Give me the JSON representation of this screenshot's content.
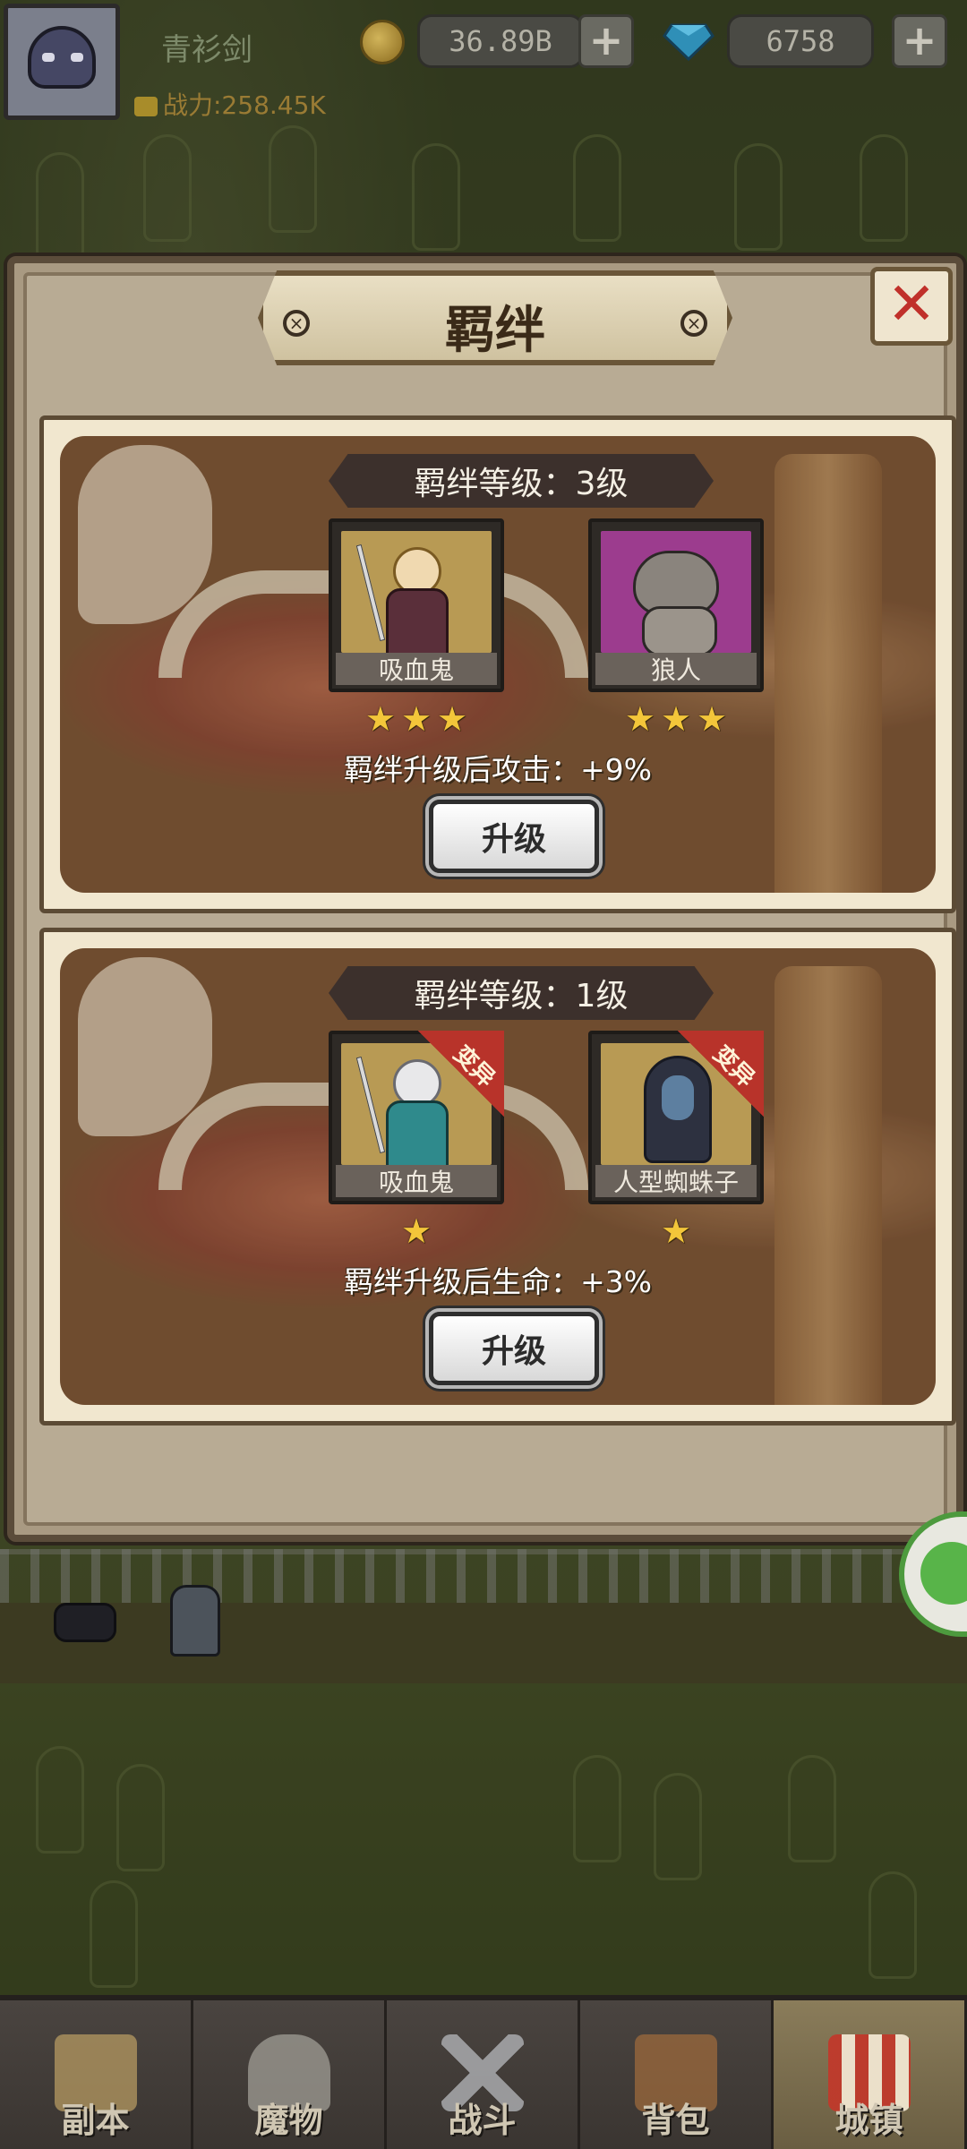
{
  "hud": {
    "player_name": "青衫剑",
    "power_label": "战力:258.45K",
    "gold_amount": "36.89B",
    "gem_amount": "6758",
    "add_symbol": "+"
  },
  "modal": {
    "title": "羁绊",
    "close_symbol": "✕",
    "rivet_symbol": "×"
  },
  "bonds": [
    {
      "level_text": "羁绊等级：3级",
      "heroes": [
        {
          "name": "吸血鬼",
          "stars": 3,
          "mutation": false
        },
        {
          "name": "狼人",
          "stars": 3,
          "mutation": false
        }
      ],
      "bonus_text": "羁绊升级后攻击：+9%",
      "upgrade_label": "升级"
    },
    {
      "level_text": "羁绊等级：1级",
      "heroes": [
        {
          "name": "吸血鬼",
          "stars": 1,
          "mutation": true,
          "mutation_label": "变异"
        },
        {
          "name": "人型蜘蛛子",
          "stars": 1,
          "mutation": true,
          "mutation_label": "变异"
        }
      ],
      "bonus_text": "羁绊升级后生命：+3%",
      "upgrade_label": "升级"
    }
  ],
  "nav": {
    "items": [
      {
        "label": "副本",
        "icon": "map-icon"
      },
      {
        "label": "魔物",
        "icon": "helmet-icon"
      },
      {
        "label": "战斗",
        "icon": "swords-icon"
      },
      {
        "label": "背包",
        "icon": "backpack-icon"
      },
      {
        "label": "城镇",
        "icon": "shop-icon"
      }
    ],
    "active_index": 4
  },
  "colors": {
    "gold": "#f3c63a",
    "close_red": "#c0302a",
    "mutation_red": "#b8332a",
    "panel": "#b8ab94",
    "chat_green": "#58b449"
  }
}
